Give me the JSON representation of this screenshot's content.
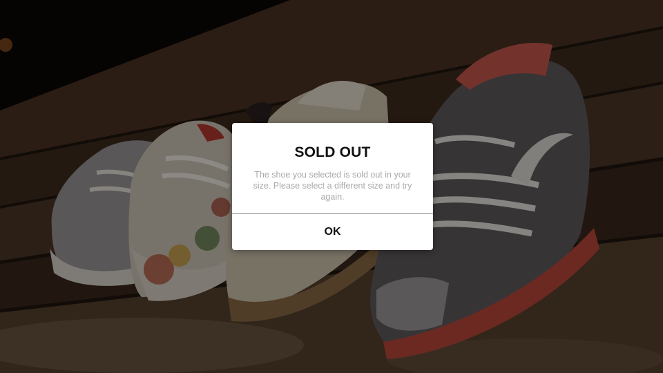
{
  "dialog": {
    "title": "SOLD OUT",
    "message": "The shoe you selected is sold out in your size. Please select a different size and try again.",
    "ok_label": "OK"
  },
  "colors": {
    "overlay": "rgba(0,0,0,0.42)",
    "dialog_background": "#ffffff",
    "title_text": "#111111",
    "message_text": "#a9a9a9",
    "divider": "#8f8f8f"
  }
}
